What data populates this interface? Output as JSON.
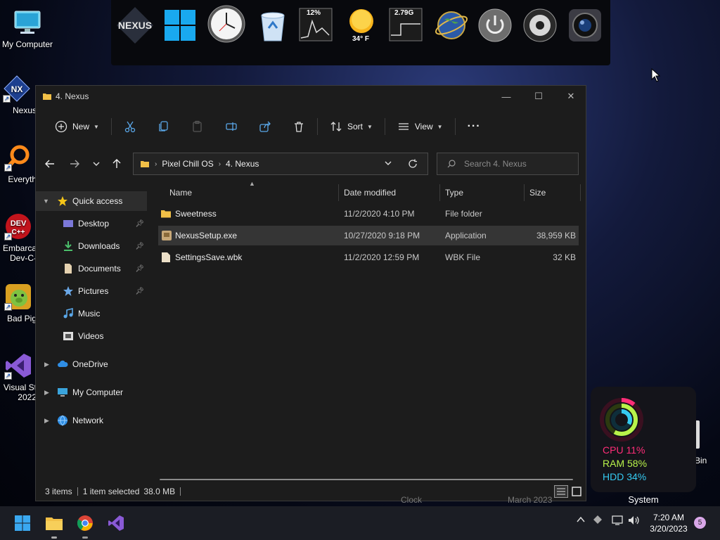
{
  "desktop": {
    "icons": [
      {
        "label": "My Computer"
      },
      {
        "label": "Nexus"
      },
      {
        "label": "Everyth"
      },
      {
        "label": "Embarca Dev-C-"
      },
      {
        "label": "Bad Pig"
      },
      {
        "label": "Visual St 2022"
      }
    ],
    "right_icon_label": "Bin",
    "ghost_labels": [
      "Clock",
      "March 2023"
    ]
  },
  "dock": {
    "logo_text": "NEXUS",
    "cpu_meter": "12%",
    "weather_temp": "34° F",
    "ram_meter": "2.79G"
  },
  "window": {
    "title": "4. Nexus",
    "toolbar": {
      "new_label": "New",
      "sort_label": "Sort",
      "view_label": "View",
      "more_label": "···"
    },
    "address": {
      "crumbs": [
        "Pixel Chill OS",
        "4. Nexus"
      ]
    },
    "search": {
      "placeholder": "Search 4. Nexus"
    },
    "nav": {
      "quick_access": "Quick access",
      "items": [
        {
          "label": "Desktop"
        },
        {
          "label": "Downloads"
        },
        {
          "label": "Documents"
        },
        {
          "label": "Pictures"
        },
        {
          "label": "Music"
        },
        {
          "label": "Videos"
        }
      ],
      "onedrive": "OneDrive",
      "my_computer": "My Computer",
      "network": "Network"
    },
    "columns": {
      "name": "Name",
      "date": "Date modified",
      "type": "Type",
      "size": "Size"
    },
    "files": [
      {
        "name": "Sweetness",
        "date": "11/2/2020 4:10 PM",
        "type": "File folder",
        "size": ""
      },
      {
        "name": "NexusSetup.exe",
        "date": "10/27/2020 9:18 PM",
        "type": "Application",
        "size": "38,959 KB"
      },
      {
        "name": "SettingsSave.wbk",
        "date": "11/2/2020 12:59 PM",
        "type": "WBK File",
        "size": "32 KB"
      }
    ],
    "status": {
      "items": "3 items",
      "selected": "1 item selected",
      "size": "38.0 MB"
    }
  },
  "widget": {
    "cpu": "CPU 11%",
    "ram": "RAM 58%",
    "hdd": "HDD 34%",
    "label": "System",
    "colors": {
      "cpu": "#ff2d78",
      "ram": "#b8f24a",
      "hdd": "#35c9f0"
    }
  },
  "taskbar": {
    "time": "7:20 AM",
    "date": "3/20/2023",
    "notifications": "5"
  }
}
